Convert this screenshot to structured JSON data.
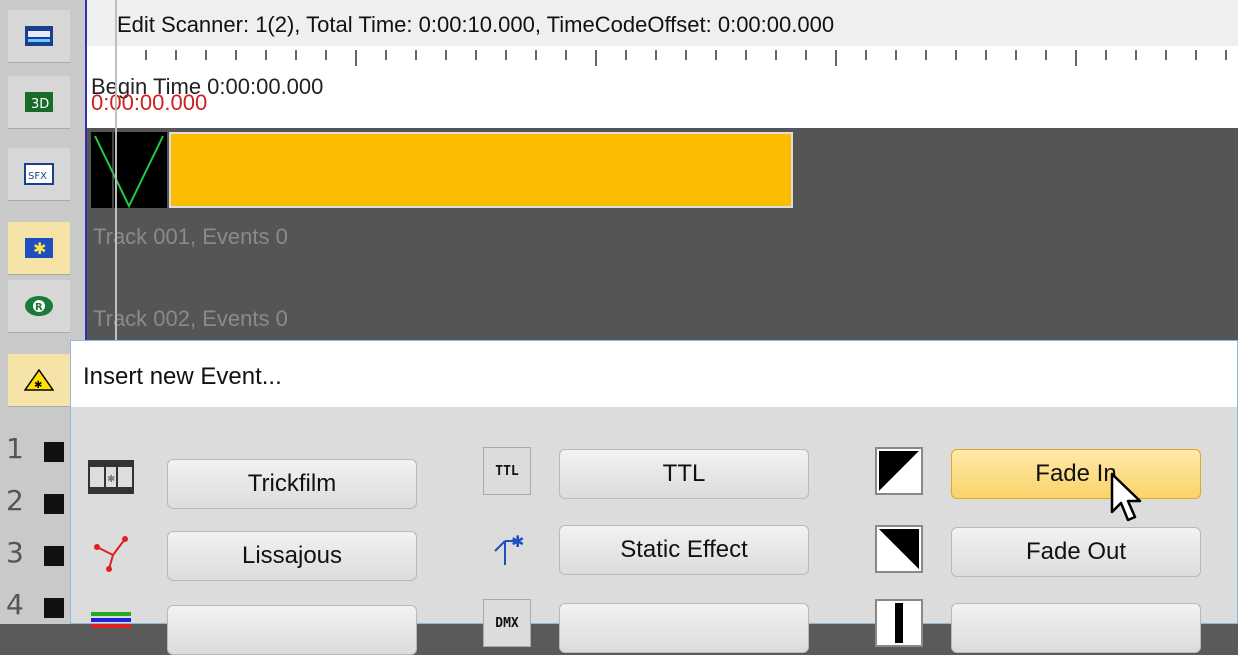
{
  "header": {
    "title": "Edit Scanner: 1(2), Total Time: 0:00:10.000, TimeCodeOffset: 0:00:00.000"
  },
  "ruler": {
    "begin_time": "Begin Time 0:00:00.000",
    "red_time": "0:00:00.000"
  },
  "tracks": [
    {
      "label": "Track 001, Events 0"
    },
    {
      "label": "Track 002, Events 0"
    }
  ],
  "sidebar": {
    "items": [
      {
        "icon": "monitor-icon"
      },
      {
        "icon": "3d-icon"
      },
      {
        "icon": "sfx-icon"
      },
      {
        "icon": "laser-star-icon"
      },
      {
        "icon": "r-logo-icon"
      },
      {
        "icon": "laser-warning-icon"
      }
    ],
    "row_numbers": [
      "1",
      "2",
      "3",
      "4"
    ]
  },
  "popup": {
    "title": "Insert new Event...",
    "buttons": {
      "trickfilm": "Trickfilm",
      "lissajous": "Lissajous",
      "ttl": "TTL",
      "static_effect": "Static Effect",
      "fade_in": "Fade In",
      "fade_out": "Fade Out"
    },
    "icon_labels": {
      "ttl": "TTL",
      "dmx": "DMX"
    }
  },
  "colors": {
    "event_bar": "#fcbc00",
    "track_bg": "#555555",
    "hover_button": "#fbd36a"
  }
}
